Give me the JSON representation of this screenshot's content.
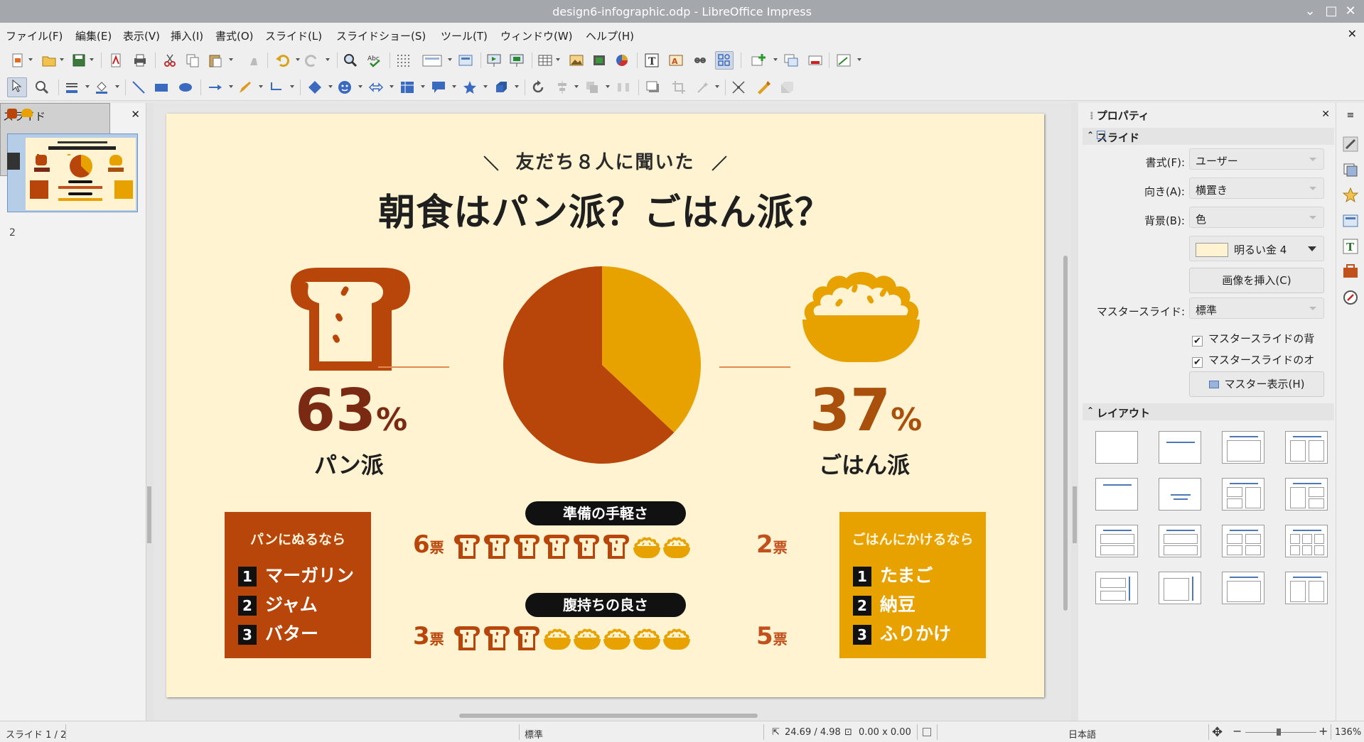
{
  "window": {
    "title": "design6-infographic.odp - LibreOffice Impress"
  },
  "menu": [
    "ファイル(F)",
    "編集(E)",
    "表示(V)",
    "挿入(I)",
    "書式(O)",
    "スライド(L)",
    "スライドショー(S)",
    "ツール(T)",
    "ウィンドウ(W)",
    "ヘルプ(H)"
  ],
  "slide_panel": {
    "title": "スライド",
    "slides": [
      "1",
      "2"
    ]
  },
  "slide": {
    "subtitle": "友だち８人に聞いた",
    "title": "朝食はパン派？ごはん派？",
    "bread": {
      "percent": "63",
      "unit": "%",
      "label": "パン派"
    },
    "rice": {
      "percent": "37",
      "unit": "%",
      "label": "ごはん派"
    },
    "pie": {
      "bread_share": 0.63,
      "rice_share": 0.37
    },
    "colors": {
      "bread": "#b8460a",
      "rice": "#e8a200",
      "bg": "#fff3d1",
      "percent_bread": "#7a2a12",
      "percent_rice": "#a8500c"
    },
    "bread_box": {
      "title": "パンにぬるなら",
      "items": [
        {
          "rank": "1",
          "name": "マーガリン"
        },
        {
          "rank": "2",
          "name": "ジャム"
        },
        {
          "rank": "3",
          "name": "バター"
        }
      ]
    },
    "rice_box": {
      "title": "ごはんにかけるなら",
      "items": [
        {
          "rank": "1",
          "name": "たまご"
        },
        {
          "rank": "2",
          "name": "納豆"
        },
        {
          "rank": "3",
          "name": "ふりかけ"
        }
      ]
    },
    "categories": [
      {
        "label": "準備の手軽さ",
        "bread_votes": "6",
        "rice_votes": "2",
        "unit": "票",
        "bread_count": 6,
        "rice_count": 2
      },
      {
        "label": "腹持ちの良さ",
        "bread_votes": "3",
        "rice_votes": "5",
        "unit": "票",
        "bread_count": 3,
        "rice_count": 5
      }
    ]
  },
  "properties": {
    "title": "プロパティ",
    "slide_section": "スライド",
    "format_label": "書式(F):",
    "format_value": "ユーザー",
    "orientation_label": "向き(A):",
    "orientation_value": "横置き",
    "background_label": "背景(B):",
    "background_value": "色",
    "color_name": "明るい金 4",
    "color_swatch": "#fff3d1",
    "insert_image": "画像を挿入(C)",
    "master_label": "マスタースライド:",
    "master_value": "標準",
    "master_bg_check": "マスタースライドの背",
    "master_obj_check": "マスタースライドのオ",
    "master_view": "マスター表示(H)",
    "layout_section": "レイアウト"
  },
  "status": {
    "slide": "スライド 1 / 2",
    "master": "標準",
    "position": "24.69 / 4.98",
    "size": "0.00 x 0.00",
    "language": "日本語",
    "zoom": "136%"
  }
}
